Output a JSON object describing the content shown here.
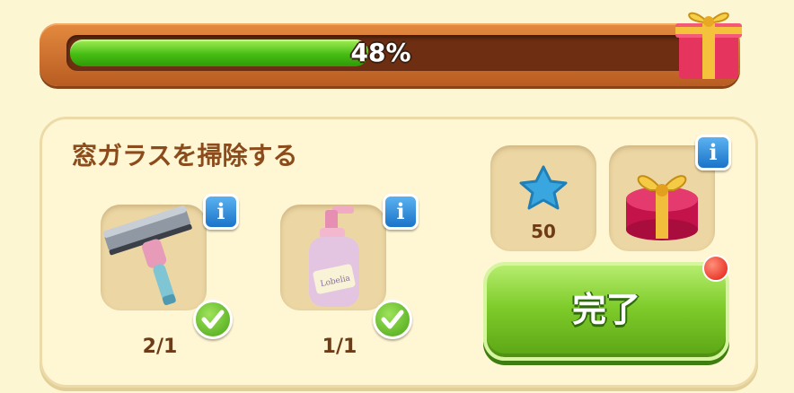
{
  "progress": {
    "percent": 48,
    "label": "48%"
  },
  "task": {
    "title": "窓ガラスを掃除する",
    "items": [
      {
        "icon": "squeegee-icon",
        "count": "2/1",
        "completed": true
      },
      {
        "icon": "soap-bottle-icon",
        "count": "1/1",
        "completed": true
      }
    ]
  },
  "rewards": {
    "star_amount": "50",
    "gift_icon": "gift-box-icon"
  },
  "done_button": {
    "label": "完了"
  },
  "colors": {
    "progress_fill": "#46bd13",
    "frame": "#c96a2a",
    "button": "#7fcc2b",
    "title_text": "#8b4b1b",
    "info": "#1a73c8",
    "notification": "#e21a0d"
  }
}
